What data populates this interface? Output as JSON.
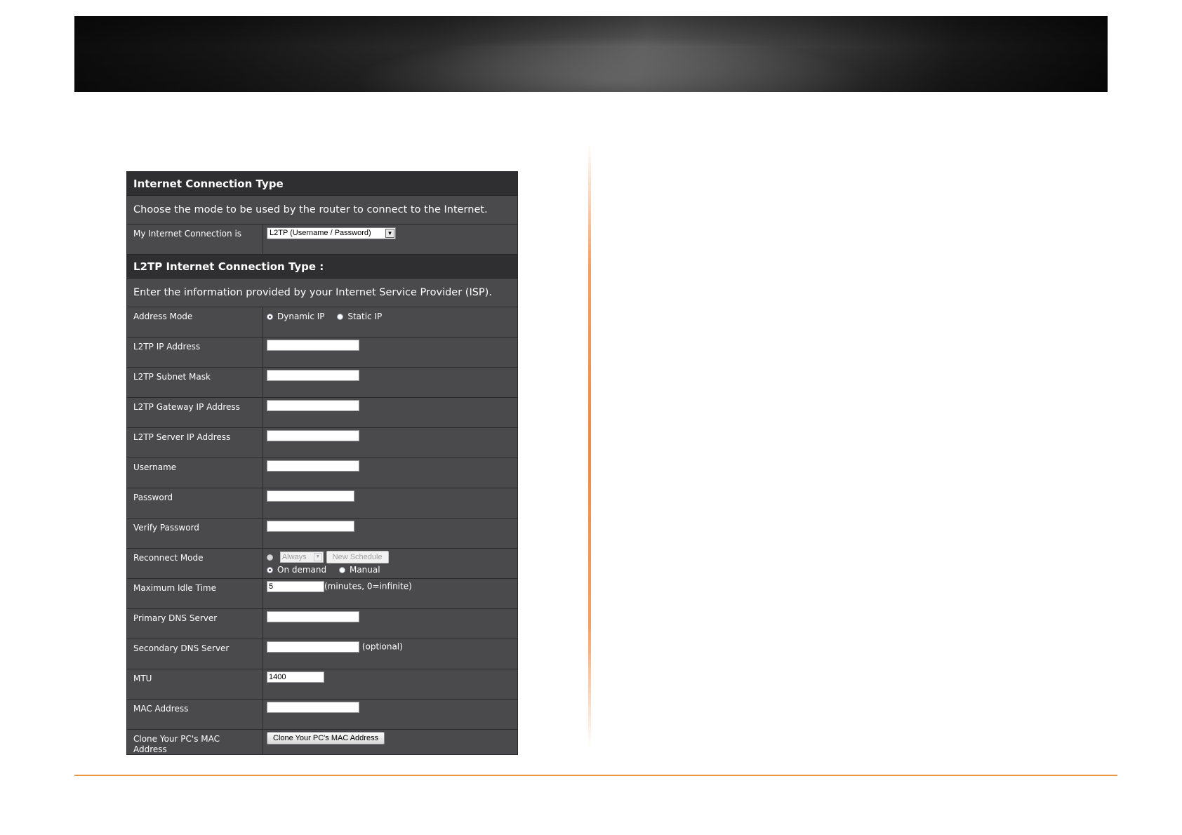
{
  "panel": {
    "connection_header": "Internet Connection Type",
    "connection_desc": "Choose the mode to be used by the router to connect to the Internet.",
    "connection_label": "My Internet Connection is",
    "connection_value": "L2TP (Username / Password)",
    "l2tp_header": "L2TP Internet Connection Type :",
    "l2tp_desc": "Enter the information provided by your Internet Service Provider (ISP).",
    "address_mode": {
      "label": "Address Mode",
      "options": [
        "Dynamic IP",
        "Static IP"
      ],
      "selected": "Dynamic IP"
    },
    "l2tp_ip": {
      "label": "L2TP IP Address",
      "value": ""
    },
    "l2tp_subnet": {
      "label": "L2TP Subnet Mask",
      "value": ""
    },
    "l2tp_gateway": {
      "label": "L2TP Gateway IP Address",
      "value": ""
    },
    "l2tp_server": {
      "label": "L2TP Server IP Address",
      "value": ""
    },
    "username": {
      "label": "Username",
      "value": ""
    },
    "password": {
      "label": "Password",
      "value": ""
    },
    "verify_password": {
      "label": "Verify Password",
      "value": ""
    },
    "reconnect": {
      "label": "Reconnect Mode",
      "schedule_value": "Always",
      "new_schedule_button": "New Schedule",
      "on_demand": "On demand",
      "manual": "Manual",
      "selected": "On demand"
    },
    "max_idle": {
      "label": "Maximum Idle Time",
      "value": "5",
      "hint": "(minutes, 0=infinite)"
    },
    "primary_dns": {
      "label": "Primary DNS Server",
      "value": ""
    },
    "secondary_dns": {
      "label": "Secondary DNS Server",
      "value": "",
      "hint": "(optional)"
    },
    "mtu": {
      "label": "MTU",
      "value": "1400"
    },
    "mac": {
      "label": "MAC Address",
      "value": ""
    },
    "clone_mac": {
      "label": "Clone Your PC's MAC Address",
      "button": "Clone Your PC's MAC Address"
    }
  }
}
